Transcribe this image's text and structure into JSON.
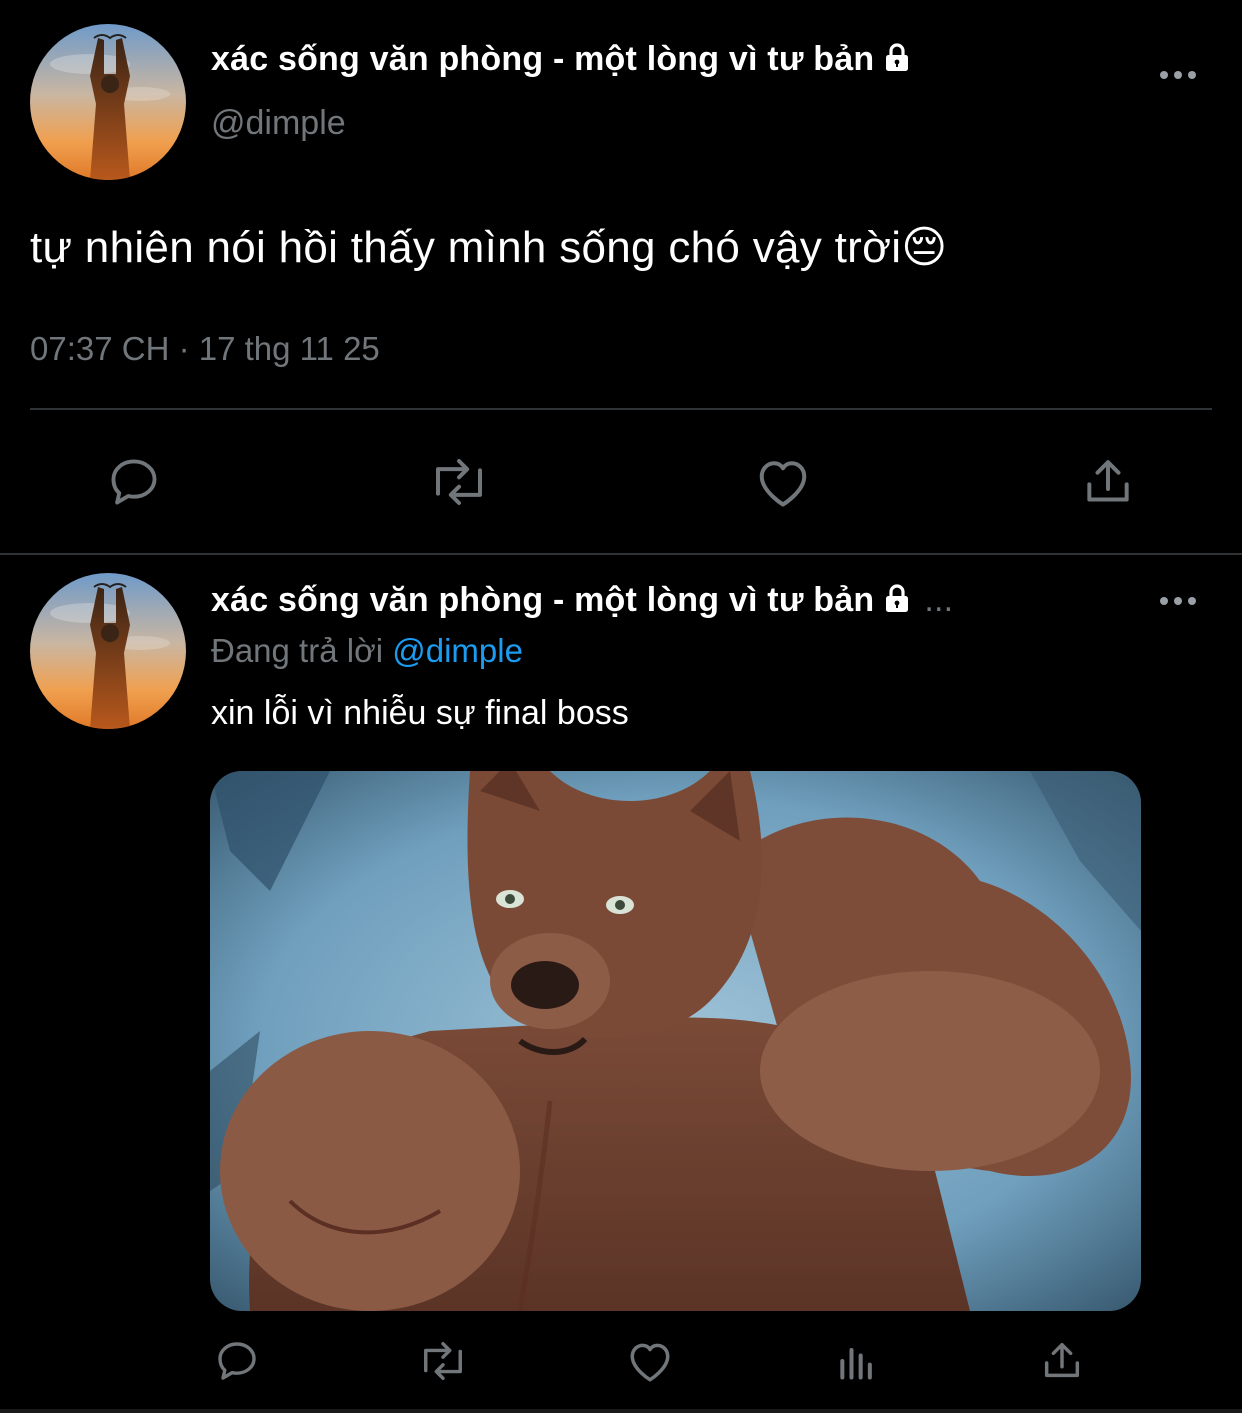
{
  "tweet1": {
    "display_name": "xác sống văn phòng - một lòng vì tư bản",
    "handle": "@dimple",
    "text": "tự nhiên nói hồi thấy mình sống chó vậy trời😔",
    "timestamp": "07:37 CH · 17 thg 11 25",
    "actions": [
      "reply-icon",
      "retweet-icon",
      "like-icon",
      "share-icon"
    ]
  },
  "tweet2": {
    "display_name": "xác sống văn phòng - một lòng vì tư bản",
    "ellipsis": "...",
    "replying_label": "Đang trả lời",
    "replying_to": "@dimple",
    "text": "xin lỗi vì nhiễu sự final boss",
    "actions": [
      "reply-icon",
      "retweet-icon",
      "like-icon",
      "analytics-icon",
      "share-icon"
    ]
  },
  "colors": {
    "background": "#000000",
    "primary_text": "#ffffff",
    "secondary_text": "#71767b",
    "accent": "#1d9bf0",
    "divider": "#2f3336"
  }
}
